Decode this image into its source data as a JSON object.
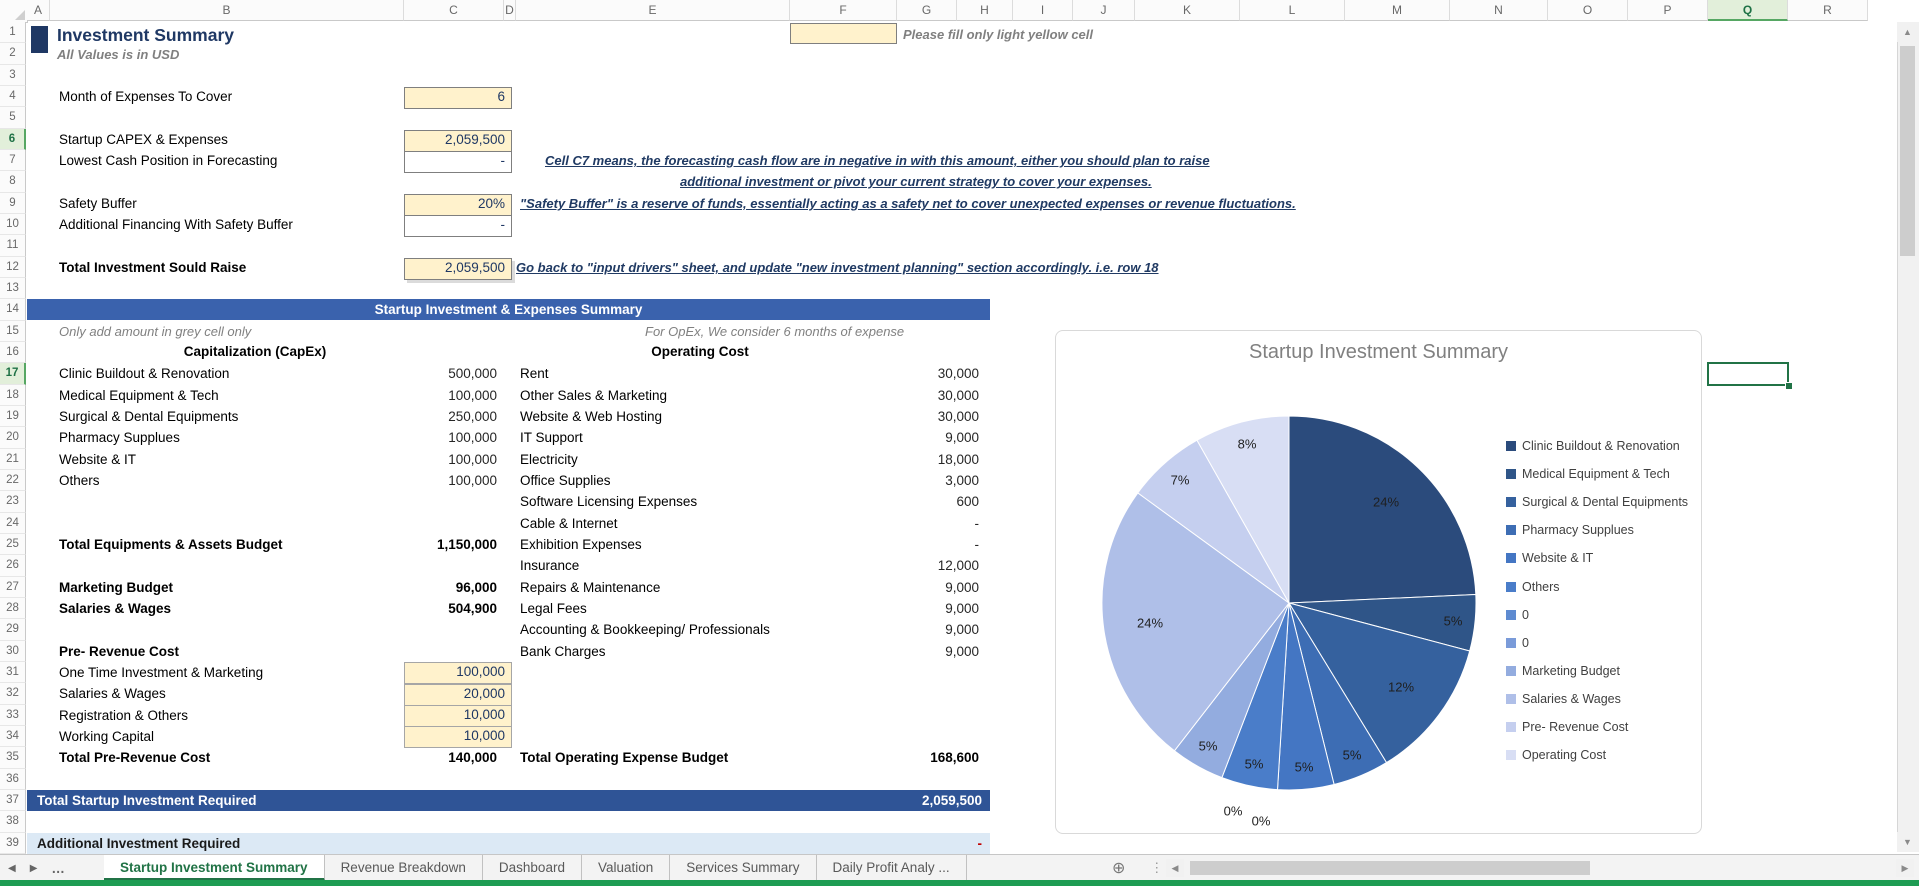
{
  "colors": {
    "accent_navy": "#1F3864",
    "band_blue": "#3A62AD",
    "band_dark": "#2F5496",
    "light_blue_band": "#DCE9F5",
    "input_yellow": "#FFF2CC",
    "tab_green": "#217346",
    "negative_red": "#C00000"
  },
  "titles": {
    "sheet_title": "Investment Summary",
    "subtitle": "All Values is in USD",
    "fill_note": "Please fill only light yellow cell"
  },
  "top": {
    "rows": [
      {
        "row": 4,
        "label": "Month of Expenses To Cover",
        "value": "6",
        "style": "yellow",
        "bold": false
      },
      {
        "row": 6,
        "label": "Startup CAPEX & Expenses",
        "value": "2,059,500",
        "style": "yellow",
        "bold": false
      },
      {
        "row": 7,
        "label": "Lowest Cash Position in Forecasting",
        "value": "-",
        "style": "plain",
        "bold": false
      },
      {
        "row": 9,
        "label": "Safety Buffer",
        "value": "20%",
        "style": "yellow",
        "bold": false
      },
      {
        "row": 10,
        "label": "Additional Financing With Safety Buffer",
        "value": "-",
        "style": "plain",
        "bold": false
      },
      {
        "row": 12,
        "label": "Total Investment Sould Raise",
        "value": "2,059,500",
        "style": "yellow shadow12",
        "bold": true
      }
    ],
    "note_c7_line1": "Cell C7 means, the forecasting cash flow are in negative in with this amount, either you should plan to raise",
    "note_c7_line2": "additional investment or pivot your current strategy to cover your expenses.",
    "note_safety": "\"Safety Buffer\" is a reserve of funds, essentially acting as a safety net to cover unexpected expenses or revenue fluctuations.",
    "note_total": "Go back to \"input drivers\" sheet, and update \"new investment planning\" section accordingly. i.e. row 18"
  },
  "summary_table": {
    "header": "Startup Investment & Expenses Summary",
    "left_note": "Only add amount in grey cell only",
    "right_note": "For OpEx, We consider 6 months of expense",
    "capex": {
      "header": "Capitalization (CapEx)",
      "items": [
        {
          "label": "Clinic Buildout & Renovation",
          "value": "500,000"
        },
        {
          "label": "Medical Equipment & Tech",
          "value": "100,000"
        },
        {
          "label": "Surgical & Dental Equipments",
          "value": "250,000"
        },
        {
          "label": "Pharmacy Supplues",
          "value": "100,000"
        },
        {
          "label": "Website & IT",
          "value": "100,000"
        },
        {
          "label": "Others",
          "value": "100,000"
        }
      ],
      "total_label": "Total Equipments & Assets Budget",
      "total_value": "1,150,000",
      "marketing_label": "Marketing Budget",
      "marketing_value": "96,000",
      "salaries_label": "Salaries & Wages",
      "salaries_value": "504,900",
      "pre_revenue_header": "Pre- Revenue Cost",
      "pre_revenue_items": [
        {
          "label": "One Time Investment & Marketing",
          "value": "100,000"
        },
        {
          "label": "Salaries & Wages",
          "value": "20,000"
        },
        {
          "label": "Registration & Others",
          "value": "10,000"
        },
        {
          "label": "Working Capital",
          "value": "10,000"
        }
      ],
      "pre_revenue_total_label": "Total Pre-Revenue Cost",
      "pre_revenue_total_value": "140,000"
    },
    "opex": {
      "header": "Operating Cost",
      "items": [
        {
          "label": "Rent",
          "value": "30,000"
        },
        {
          "label": "Other Sales & Marketing",
          "value": "30,000"
        },
        {
          "label": "Website & Web Hosting",
          "value": "30,000"
        },
        {
          "label": "IT Support",
          "value": "9,000"
        },
        {
          "label": "Electricity",
          "value": "18,000"
        },
        {
          "label": "Office Supplies",
          "value": "3,000"
        },
        {
          "label": "Software Licensing Expenses",
          "value": "600"
        },
        {
          "label": "Cable & Internet",
          "value": "-"
        },
        {
          "label": "Exhibition Expenses",
          "value": "-"
        },
        {
          "label": "Insurance",
          "value": "12,000"
        },
        {
          "label": "Repairs & Maintenance",
          "value": "9,000"
        },
        {
          "label": "Legal Fees",
          "value": "9,000"
        },
        {
          "label": "Accounting & Bookkeeping/ Professionals",
          "value": "9,000"
        },
        {
          "label": "Bank Charges",
          "value": "9,000"
        }
      ],
      "total_label": "Total Operating Expense Budget",
      "total_value": "168,600"
    },
    "total_row": {
      "label": "Total Startup Investment Required",
      "value": "2,059,500"
    },
    "additional_row": {
      "label": "Additional Investment Required",
      "value": "-"
    }
  },
  "chart_data": {
    "type": "pie",
    "title": "Startup Investment Summary",
    "categories": [
      "Clinic Buildout & Renovation",
      "Medical Equipment & Tech",
      "Surgical & Dental Equipments",
      "Pharmacy Supplues",
      "Website & IT",
      "Others",
      "0",
      "0",
      "Marketing Budget",
      "Salaries & Wages",
      "Pre- Revenue Cost",
      "Operating Cost"
    ],
    "values": [
      500000,
      100000,
      250000,
      100000,
      100000,
      100000,
      0,
      0,
      96000,
      504900,
      140000,
      168600
    ],
    "percent_labels": [
      "24%",
      "5%",
      "12%",
      "5%",
      "5%",
      "5%",
      "0%",
      "0%",
      "5%",
      "24%",
      "7%",
      "8%"
    ],
    "colors": [
      "#2B4B7C",
      "#2F5588",
      "#35619E",
      "#3D6DB4",
      "#4476C3",
      "#4A7DC9",
      "#5E8BD1",
      "#7A9BD9",
      "#93ACDF",
      "#AFBFE8",
      "#C5CFEF",
      "#D8DEF4"
    ],
    "legend_position": "right"
  },
  "sheet": {
    "column_headers": [
      "A",
      "B",
      "C",
      "D",
      "E",
      "F",
      "G",
      "H",
      "I",
      "J",
      "K",
      "L",
      "M",
      "N",
      "O",
      "P",
      "Q",
      "R"
    ],
    "row_count": 39,
    "selected_column": "Q",
    "selected_rows": [
      6,
      17
    ]
  },
  "tabs": {
    "nav_left": "◀",
    "nav_right": "▶",
    "overflow": "…",
    "items": [
      "Startup Investment Summary",
      "Revenue Breakdown",
      "Dashboard",
      "Valuation",
      "Services Summary",
      "Daily Profit Analy ..."
    ],
    "active": "Startup Investment Summary",
    "add_sheet": "⊕",
    "dots": "⋮"
  },
  "scrollbar": {
    "up": "▲",
    "down": "▼",
    "left": "◀",
    "right": "▶"
  }
}
